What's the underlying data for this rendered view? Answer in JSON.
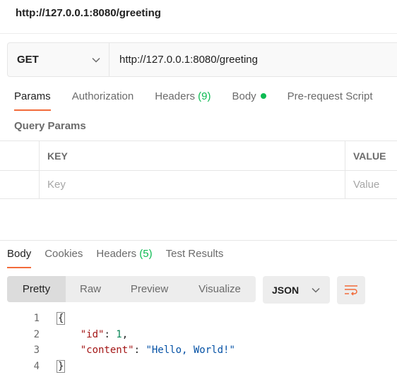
{
  "request_title": "http://127.0.0.1:8080/greeting",
  "url_bar": {
    "method": "GET",
    "url": "http://127.0.0.1:8080/greeting"
  },
  "request_tabs": {
    "params": "Params",
    "authorization": "Authorization",
    "headers": "Headers",
    "headers_count": "(9)",
    "body": "Body",
    "prerequest": "Pre-request Script"
  },
  "query_params": {
    "title": "Query Params",
    "key_header": "KEY",
    "value_header": "VALUE",
    "key_placeholder": "Key",
    "value_placeholder": "Value"
  },
  "response_tabs": {
    "body": "Body",
    "cookies": "Cookies",
    "headers": "Headers",
    "headers_count": "(5)",
    "test_results": "Test Results"
  },
  "view_modes": [
    "Pretty",
    "Raw",
    "Preview",
    "Visualize"
  ],
  "format": "JSON",
  "response_code": {
    "line_numbers": [
      "1",
      "2",
      "3",
      "4"
    ],
    "open_brace": "{",
    "close_brace": "}",
    "id_key": "\"id\"",
    "id_value": "1",
    "content_key": "\"content\"",
    "content_value": "\"Hello, World!\""
  },
  "colors": {
    "accent": "#f26b3a",
    "success": "#0cbb52",
    "json_key": "#a31515",
    "json_number": "#098658",
    "json_string": "#0451a5"
  }
}
